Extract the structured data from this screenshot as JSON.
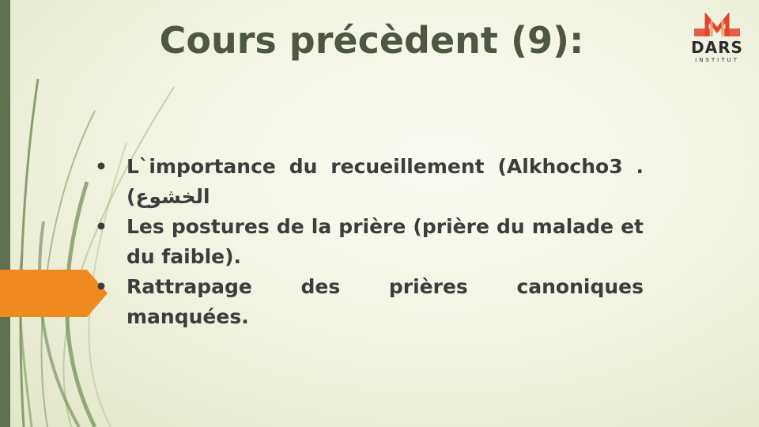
{
  "slide": {
    "title": "Cours précèdent (9):",
    "bullets": [
      "L`importance du recueillement (Alkhocho3 .(الخشوع",
      "Les postures de la prière (prière du malade et du faible).",
      "Rattrapage des prières canoniques manquées."
    ],
    "bullet_symbol": "•"
  },
  "logo": {
    "word": "DARS",
    "sub": "INSTITUT",
    "accent_color": "#e0442c"
  },
  "colors": {
    "title": "#4e5740",
    "text": "#3d3d3d",
    "left_bar": "#5f7150",
    "orange_tab": "#ef8a1e",
    "background": "#f3f4e4"
  }
}
